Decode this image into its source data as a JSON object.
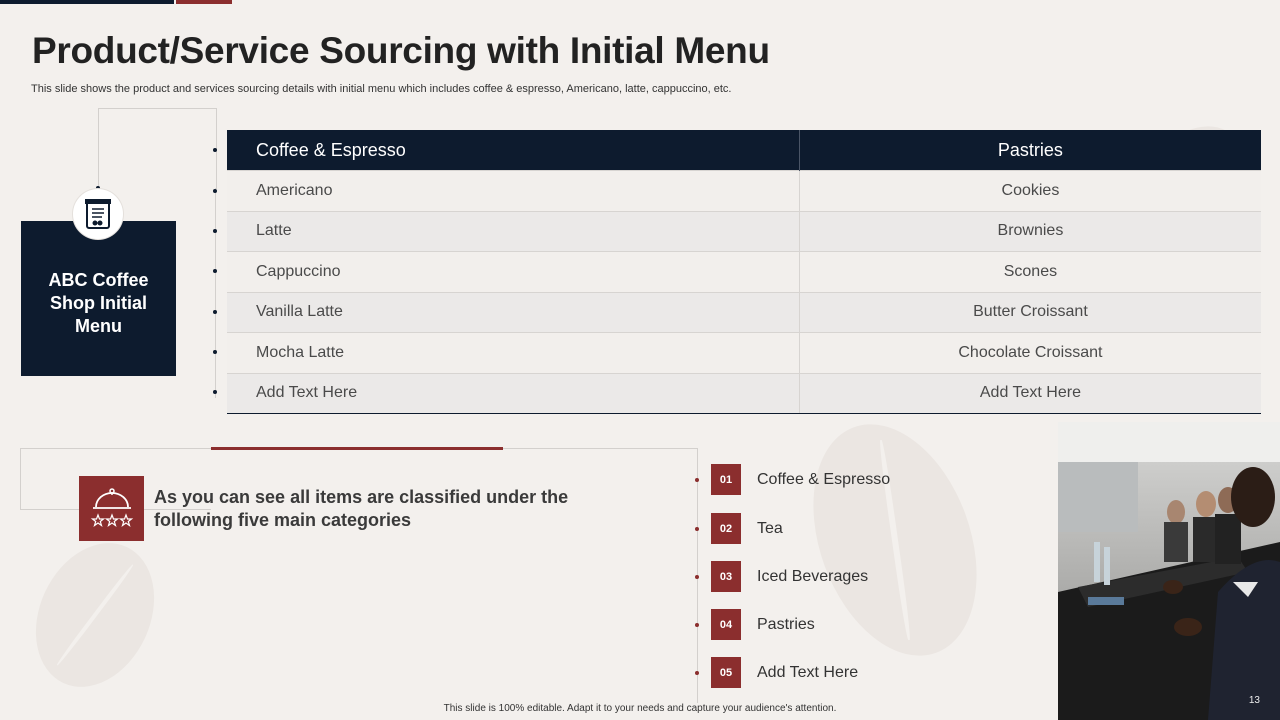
{
  "header": {
    "title": "Product/Service Sourcing with Initial Menu",
    "subtitle": "This slide shows the product and services sourcing details with initial menu which includes coffee & espresso, Americano, latte, cappuccino, etc."
  },
  "menu_box": {
    "title": "ABC Coffee Shop Initial Menu",
    "icon": "menu-card-icon"
  },
  "menu_table": {
    "headers": [
      "Coffee & Espresso",
      "Pastries"
    ],
    "rows": [
      [
        "Americano",
        "Cookies"
      ],
      [
        "Latte",
        "Brownies"
      ],
      [
        "Cappuccino",
        "Scones"
      ],
      [
        "Vanilla Latte",
        "Butter Croissant"
      ],
      [
        "Mocha Latte",
        "Chocolate Croissant"
      ],
      [
        "Add Text Here",
        "Add Text Here"
      ]
    ]
  },
  "note": {
    "icon": "cloche-stars-icon",
    "text": "As you can see all items are classified under the following five main categories"
  },
  "categories": [
    {
      "num": "01",
      "label": "Coffee & Espresso"
    },
    {
      "num": "02",
      "label": "Tea"
    },
    {
      "num": "03",
      "label": "Iced Beverages"
    },
    {
      "num": "04",
      "label": "Pastries"
    },
    {
      "num": "05",
      "label": "Add Text Here"
    }
  ],
  "page_number": "13",
  "footer": "This slide is 100% editable.  Adapt it to your needs and capture your audience's attention.",
  "colors": {
    "navy": "#0d1b2e",
    "maroon": "#8b2e2e",
    "background": "#f3f0ed"
  }
}
